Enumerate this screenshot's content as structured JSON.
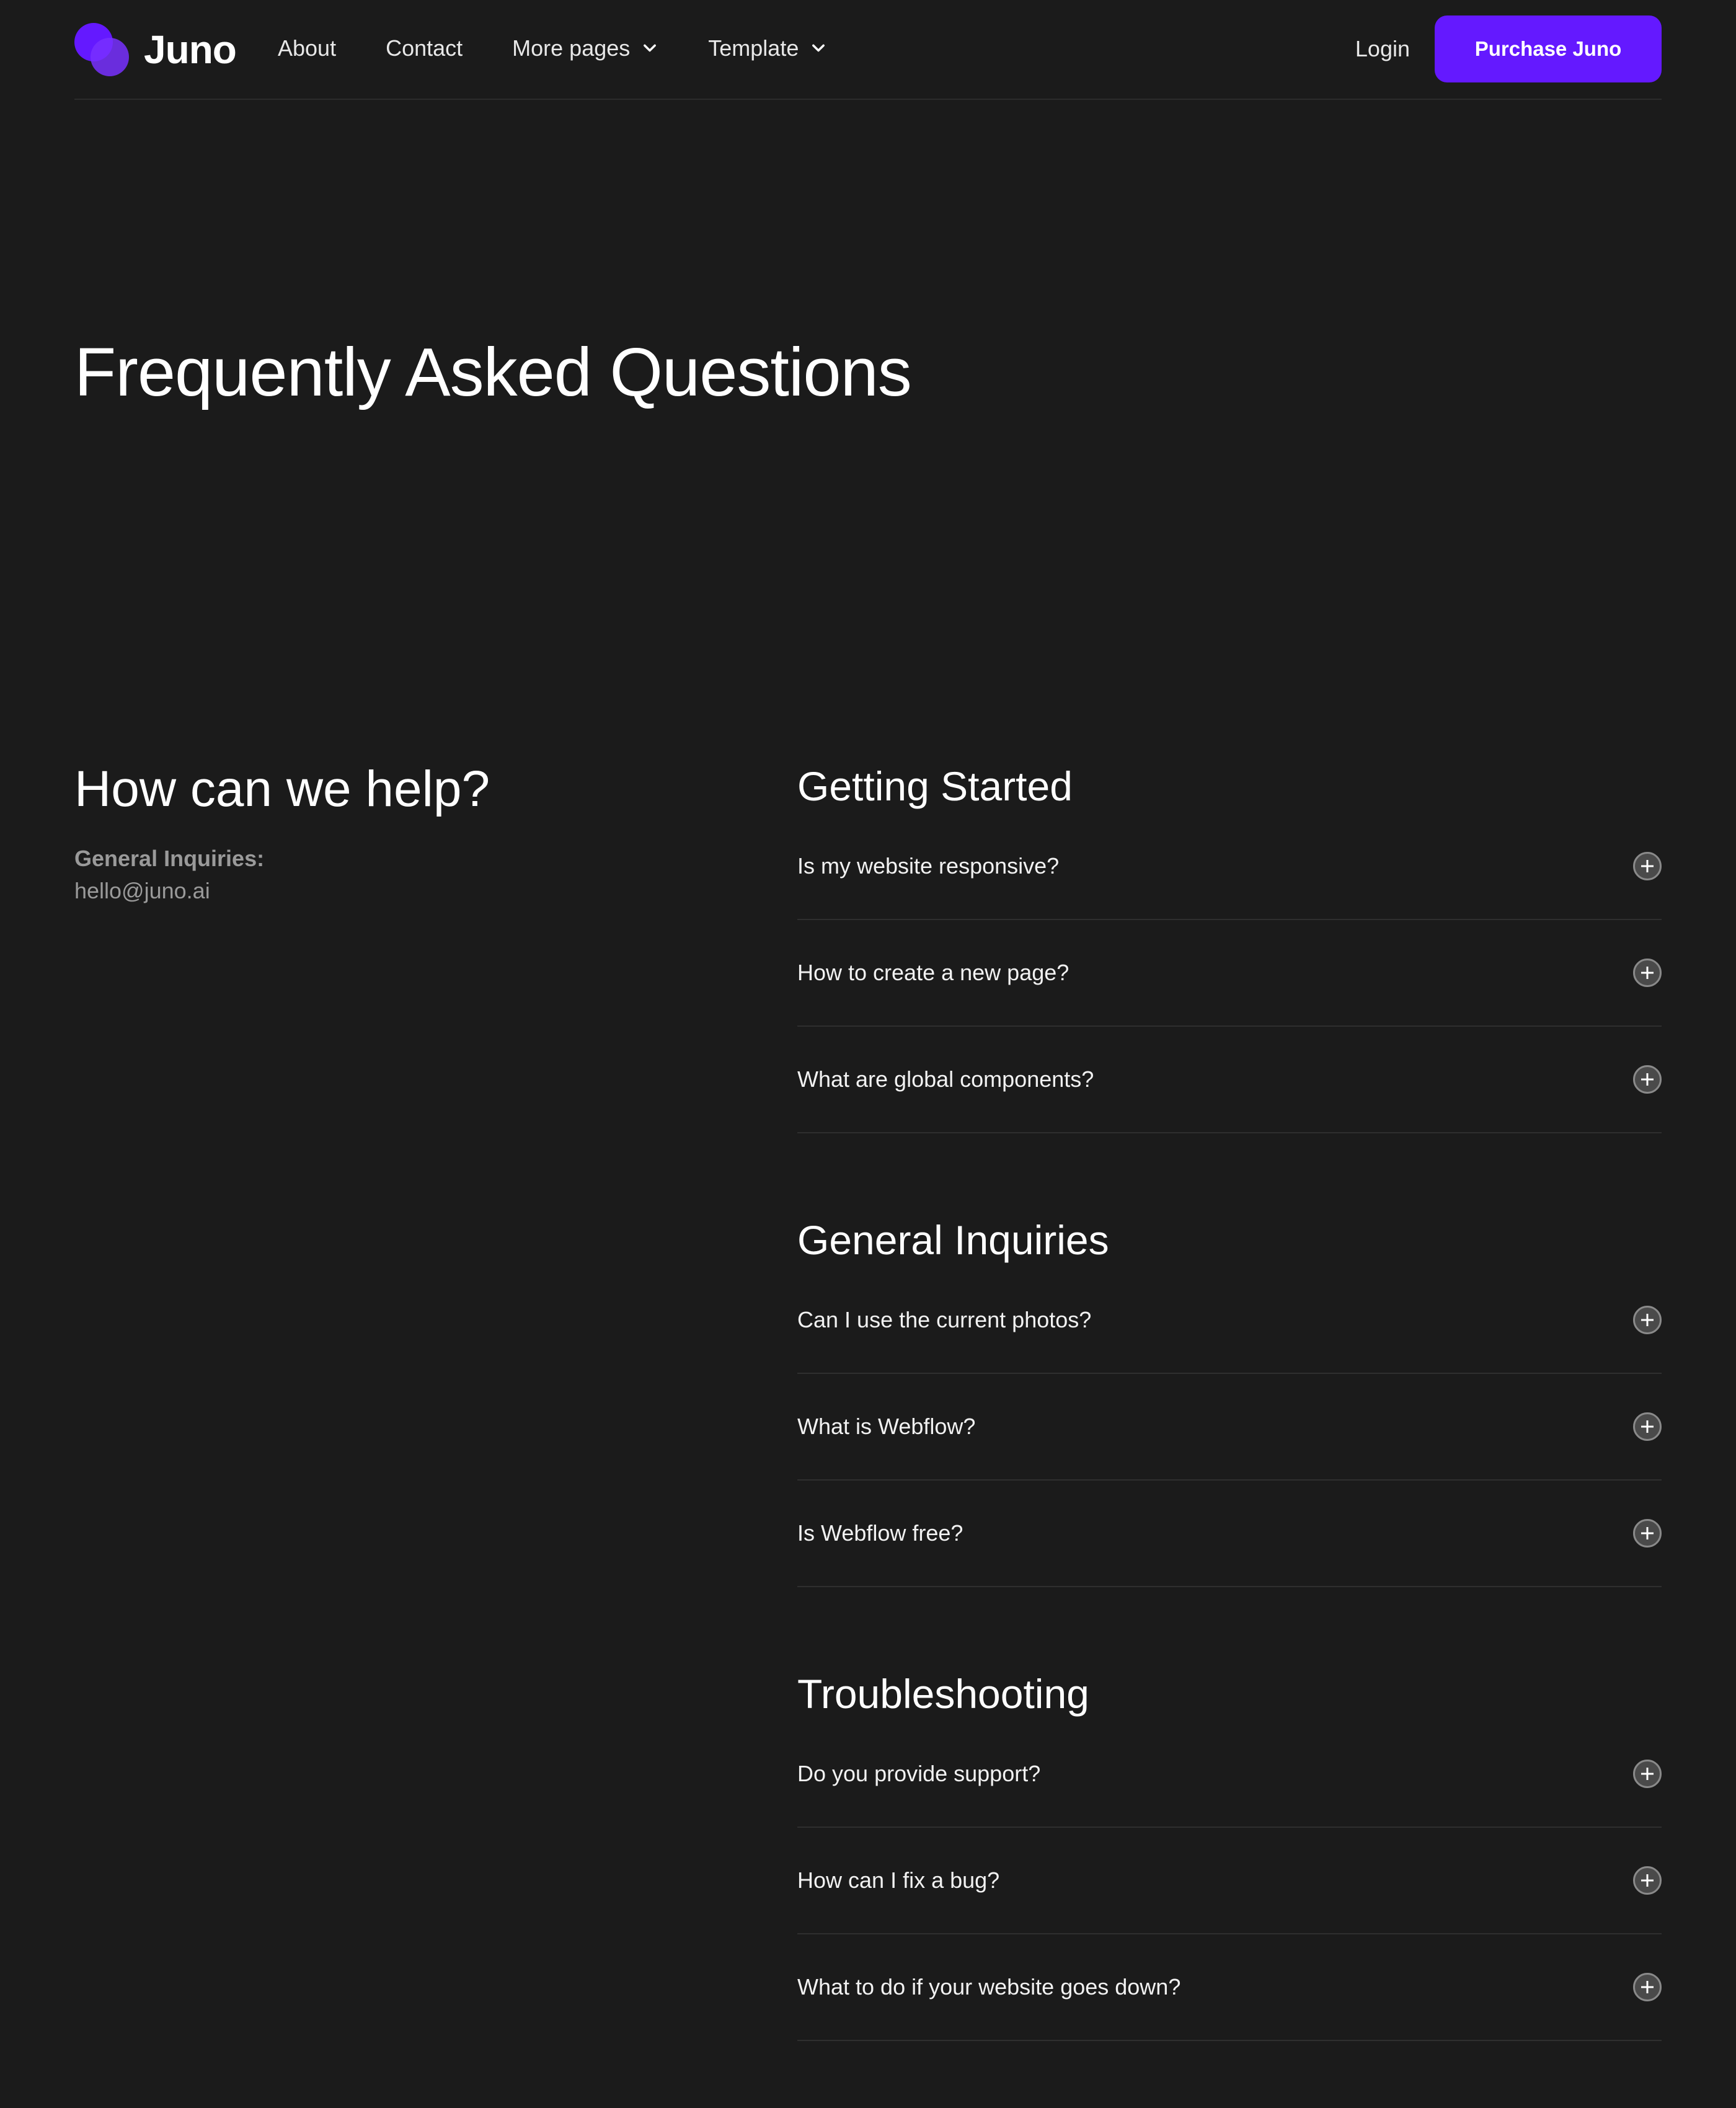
{
  "nav": {
    "brand": "Juno",
    "links": [
      "About",
      "Contact",
      "More pages",
      "Template"
    ],
    "login": "Login",
    "cta": "Purchase Juno",
    "accent_color": "#6419ff"
  },
  "hero": {
    "title": "Frequently Asked Questions"
  },
  "help": {
    "title": "How can we help?",
    "inquiries_label": "General Inquiries:",
    "email": "hello@juno.ai"
  },
  "faq": {
    "sections": [
      {
        "title": "Getting Started",
        "questions": [
          "Is my website responsive?",
          "How to create a new page?",
          "What are global components?"
        ]
      },
      {
        "title": "General Inquiries",
        "questions": [
          "Can I use the current photos?",
          "What is Webflow?",
          "Is Webflow free?"
        ]
      },
      {
        "title": "Troubleshooting",
        "questions": [
          "Do you provide support?",
          "How can I fix a bug?",
          "What to do if your website goes down?"
        ]
      }
    ]
  }
}
